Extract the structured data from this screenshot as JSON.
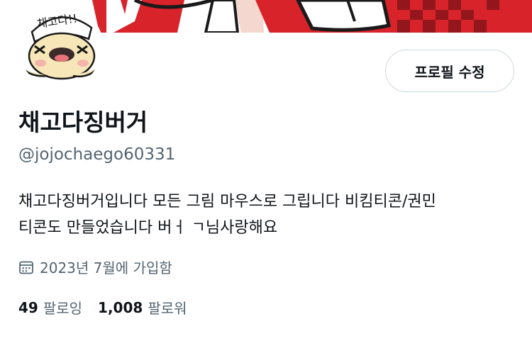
{
  "profile": {
    "avatar_caption": "채고다!!",
    "edit_button_label": "프로필 수정",
    "display_name": "채고다징버거",
    "handle": "@jojochaego60331",
    "bio_line1": "채고다징버거입니다 모든 그림 마우스로 그립니다 비킴티콘/권민",
    "bio_line2": "티콘도 만들었습니다 버ㅓ ㄱ님사랑해요",
    "joined_text": "2023년 7월에 가입함",
    "joined_icon": "calendar-icon",
    "following_count": "49",
    "following_label": "팔로잉",
    "followers_count": "1,008",
    "followers_label": "팔로워"
  },
  "colors": {
    "text_primary": "#0f1419",
    "text_secondary": "#536471",
    "button_border": "#cfd9de",
    "banner_red": "#d8232a"
  }
}
